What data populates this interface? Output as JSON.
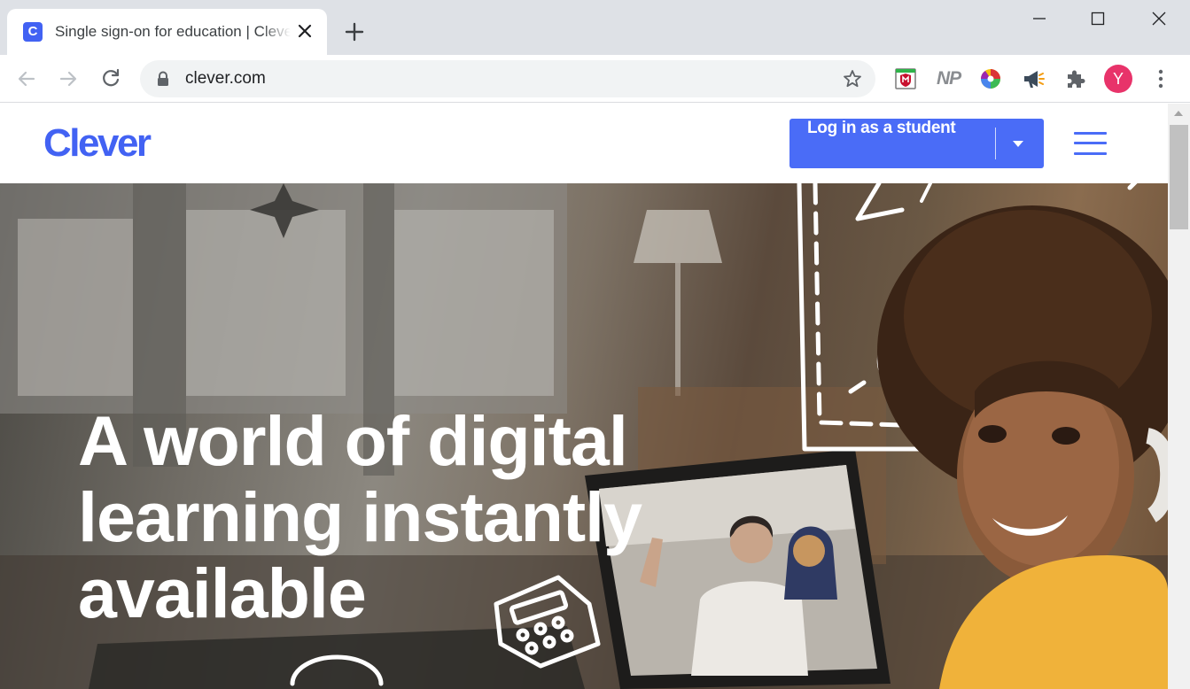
{
  "browser": {
    "tab": {
      "favicon_letter": "C",
      "title": "Single sign-on for education | Clever"
    },
    "address_bar": {
      "url": "clever.com"
    },
    "extensions": [
      "mcafee-icon",
      "np-icon",
      "color-wheel-icon",
      "megaphone-icon",
      "puzzle-icon"
    ],
    "extension_np_label": "NP",
    "profile_initial": "Y",
    "colors": {
      "tabstrip": "#dee1e6",
      "favicon": "#4262f3",
      "avatar": "#e8336a"
    }
  },
  "site": {
    "logo_text": "Clever",
    "login_button": {
      "label": "Log in as a student"
    },
    "hero": {
      "title_lines": [
        "A world of digital",
        "learning instantly",
        "available"
      ]
    },
    "colors": {
      "brand": "#4262f3",
      "button": "#4a6cf7"
    }
  }
}
